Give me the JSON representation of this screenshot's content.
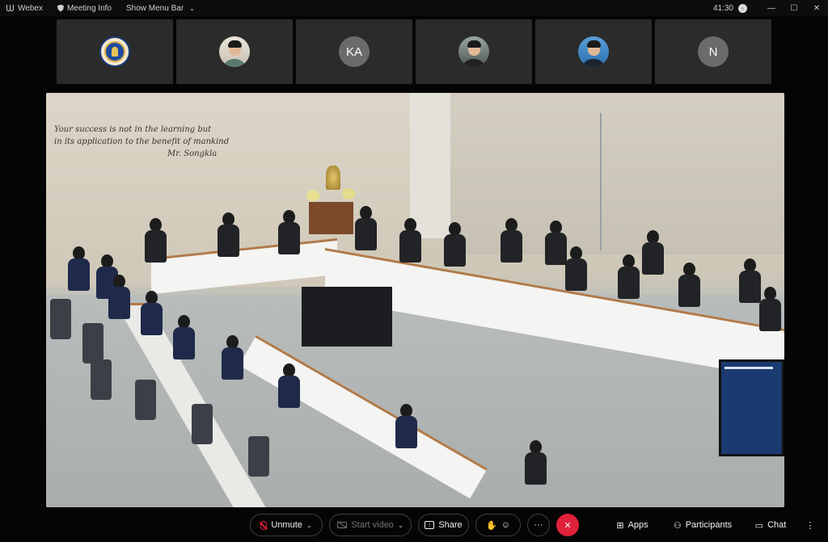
{
  "titlebar": {
    "app_name": "Webex",
    "meeting_info": "Meeting Info",
    "show_menu_bar": "Show Menu Bar",
    "timer": "41:30",
    "window_controls": {
      "minimize": "—",
      "maximize": "☐",
      "close": "✕"
    }
  },
  "participants": [
    {
      "type": "seal",
      "initials": ""
    },
    {
      "type": "photo",
      "initials": ""
    },
    {
      "type": "initials",
      "initials": "KA"
    },
    {
      "type": "photo",
      "initials": ""
    },
    {
      "type": "photo",
      "initials": ""
    },
    {
      "type": "initials",
      "initials": "N"
    }
  ],
  "video": {
    "wall_quote_line1": "Your success is not in the learning but",
    "wall_quote_line2": "in its application to the benefit of mankind",
    "wall_quote_signature": "Mr. Songkla"
  },
  "controls": {
    "unmute_label": "Unmute",
    "start_video_label": "Start video",
    "share_label": "Share",
    "more_label": "···",
    "end_label": "✕",
    "apps_label": "Apps",
    "participants_label": "Participants",
    "chat_label": "Chat",
    "overflow_label": "⋮"
  },
  "colors": {
    "end_button": "#e0213a",
    "muted_icon": "#e0213a",
    "tile_bg": "#2b2b2b",
    "background": "#050505"
  }
}
